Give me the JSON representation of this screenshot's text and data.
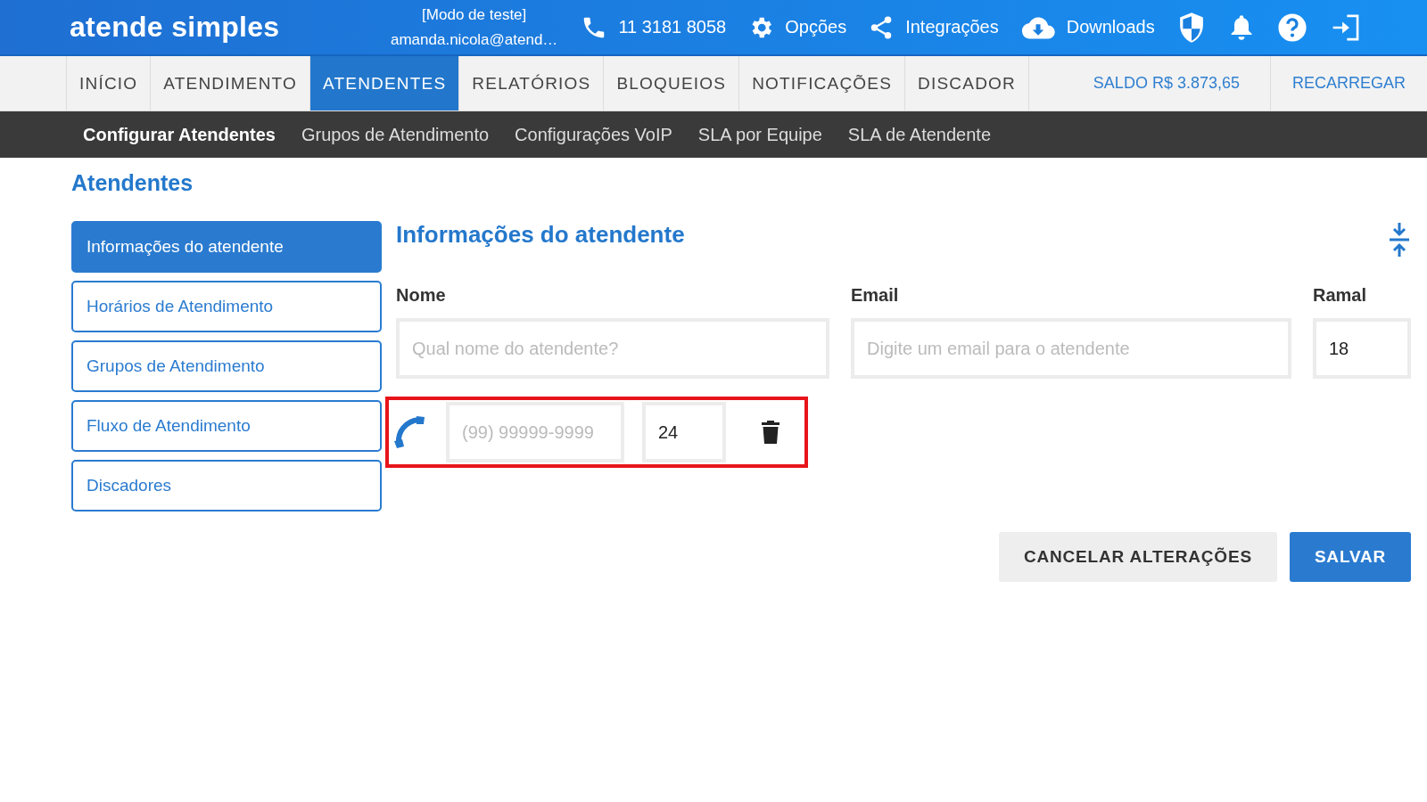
{
  "header": {
    "logo": "atende simples",
    "mode": "[Modo de teste]",
    "user": "amanda.nicola@atend…",
    "items": [
      {
        "kind": "phone",
        "label": "11 3181 8058"
      },
      {
        "kind": "gear",
        "label": "Opções"
      },
      {
        "kind": "share",
        "label": "Integrações"
      },
      {
        "kind": "cloud",
        "label": "Downloads"
      },
      {
        "kind": "shield"
      },
      {
        "kind": "bell"
      },
      {
        "kind": "help"
      },
      {
        "kind": "logout"
      }
    ]
  },
  "tabs": [
    {
      "label": "INÍCIO",
      "selected": false
    },
    {
      "label": "ATENDIMENTO",
      "selected": false
    },
    {
      "label": "ATENDENTES",
      "selected": true
    },
    {
      "label": "RELATÓRIOS",
      "selected": false
    },
    {
      "label": "BLOQUEIOS",
      "selected": false
    },
    {
      "label": "NOTIFICAÇÕES",
      "selected": false
    },
    {
      "label": "DISCADOR",
      "selected": false
    }
  ],
  "balance": "SALDO R$ 3.873,65",
  "recharge": "RECARREGAR",
  "subnav": [
    {
      "label": "Configurar Atendentes",
      "selected": true
    },
    {
      "label": "Grupos de Atendimento",
      "selected": false
    },
    {
      "label": "Configurações VoIP",
      "selected": false
    },
    {
      "label": "SLA por Equipe",
      "selected": false
    },
    {
      "label": "SLA de Atendente",
      "selected": false
    }
  ],
  "page_title": "Atendentes",
  "sidebar": {
    "items": [
      {
        "label": "Informações do atendente",
        "selected": true
      },
      {
        "label": "Horários de Atendimento",
        "selected": false
      },
      {
        "label": "Grupos de Atendimento",
        "selected": false
      },
      {
        "label": "Fluxo de Atendimento",
        "selected": false
      },
      {
        "label": "Discadores",
        "selected": false
      }
    ]
  },
  "form": {
    "title": "Informações do atendente",
    "fields": [
      {
        "label": "Nome",
        "placeholder": "Qual nome do atendente?"
      },
      {
        "label": "Email",
        "placeholder": "Digite um email para o atendente"
      },
      {
        "label": "Ramal",
        "value": "18"
      }
    ],
    "phone_row": {
      "highlighted": true,
      "phone": {
        "placeholder": "(99) 99999-9999"
      },
      "extension": {
        "value": "24"
      }
    }
  },
  "buttons": [
    {
      "kind": "secondary",
      "label": "CANCELAR ALTERAÇÕES"
    },
    {
      "kind": "primary",
      "label": "SALVAR"
    }
  ]
}
